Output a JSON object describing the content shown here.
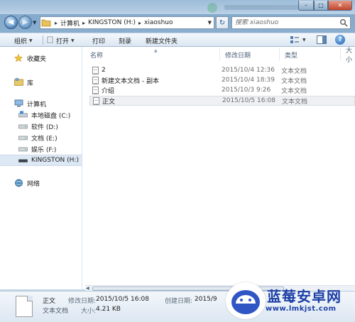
{
  "window": {
    "controls": {
      "minimize": "–",
      "maximize": "□",
      "close": "✕"
    }
  },
  "address": {
    "segments": [
      "计算机",
      "KINGSTON (H:)",
      "xiaoshuo"
    ],
    "search_placeholder": "搜索 xiaoshuo"
  },
  "toolbar": {
    "organize": "组织",
    "open": "打开",
    "print": "打印",
    "burn": "刻录",
    "new_folder": "新建文件夹"
  },
  "navpane": {
    "favorites": "收藏夹",
    "libraries": "库",
    "computer": "计算机",
    "drives": [
      "本地磁盘 (C:)",
      "软件 (D:)",
      "文档 (E:)",
      "娱乐 (F:)",
      "KINGSTON (H:)"
    ],
    "network": "网络"
  },
  "columns": {
    "name": "名称",
    "date": "修改日期",
    "type": "类型",
    "size": "大小"
  },
  "files": [
    {
      "name": "2",
      "date": "2015/10/4 12:36",
      "type": "文本文档"
    },
    {
      "name": "新建文本文档 - 副本",
      "date": "2015/10/4 18:39",
      "type": "文本文档"
    },
    {
      "name": "介绍",
      "date": "2015/10/3 9:26",
      "type": "文本文档"
    },
    {
      "name": "正文",
      "date": "2015/10/5 16:08",
      "type": "文本文档"
    }
  ],
  "details": {
    "name": "正文",
    "type": "文本文档",
    "modified_label": "修改日期:",
    "modified_value": "2015/10/5 16:08",
    "size_label": "大小:",
    "size_value": "4.21 KB",
    "created_label": "创建日期:",
    "created_value": "2015/9"
  },
  "watermark": {
    "brand": "蓝莓安卓网",
    "url": "www.lmkjst.com"
  },
  "colors": {
    "selection": "#dde8f5",
    "accent": "#1c3fa6",
    "chrome": "#a9c5de"
  },
  "icons": {
    "back": "arrow-left-icon",
    "forward": "arrow-right-icon",
    "folder": "folder-icon",
    "search": "magnifier-icon",
    "help": "question-icon",
    "document": "text-document-icon"
  }
}
